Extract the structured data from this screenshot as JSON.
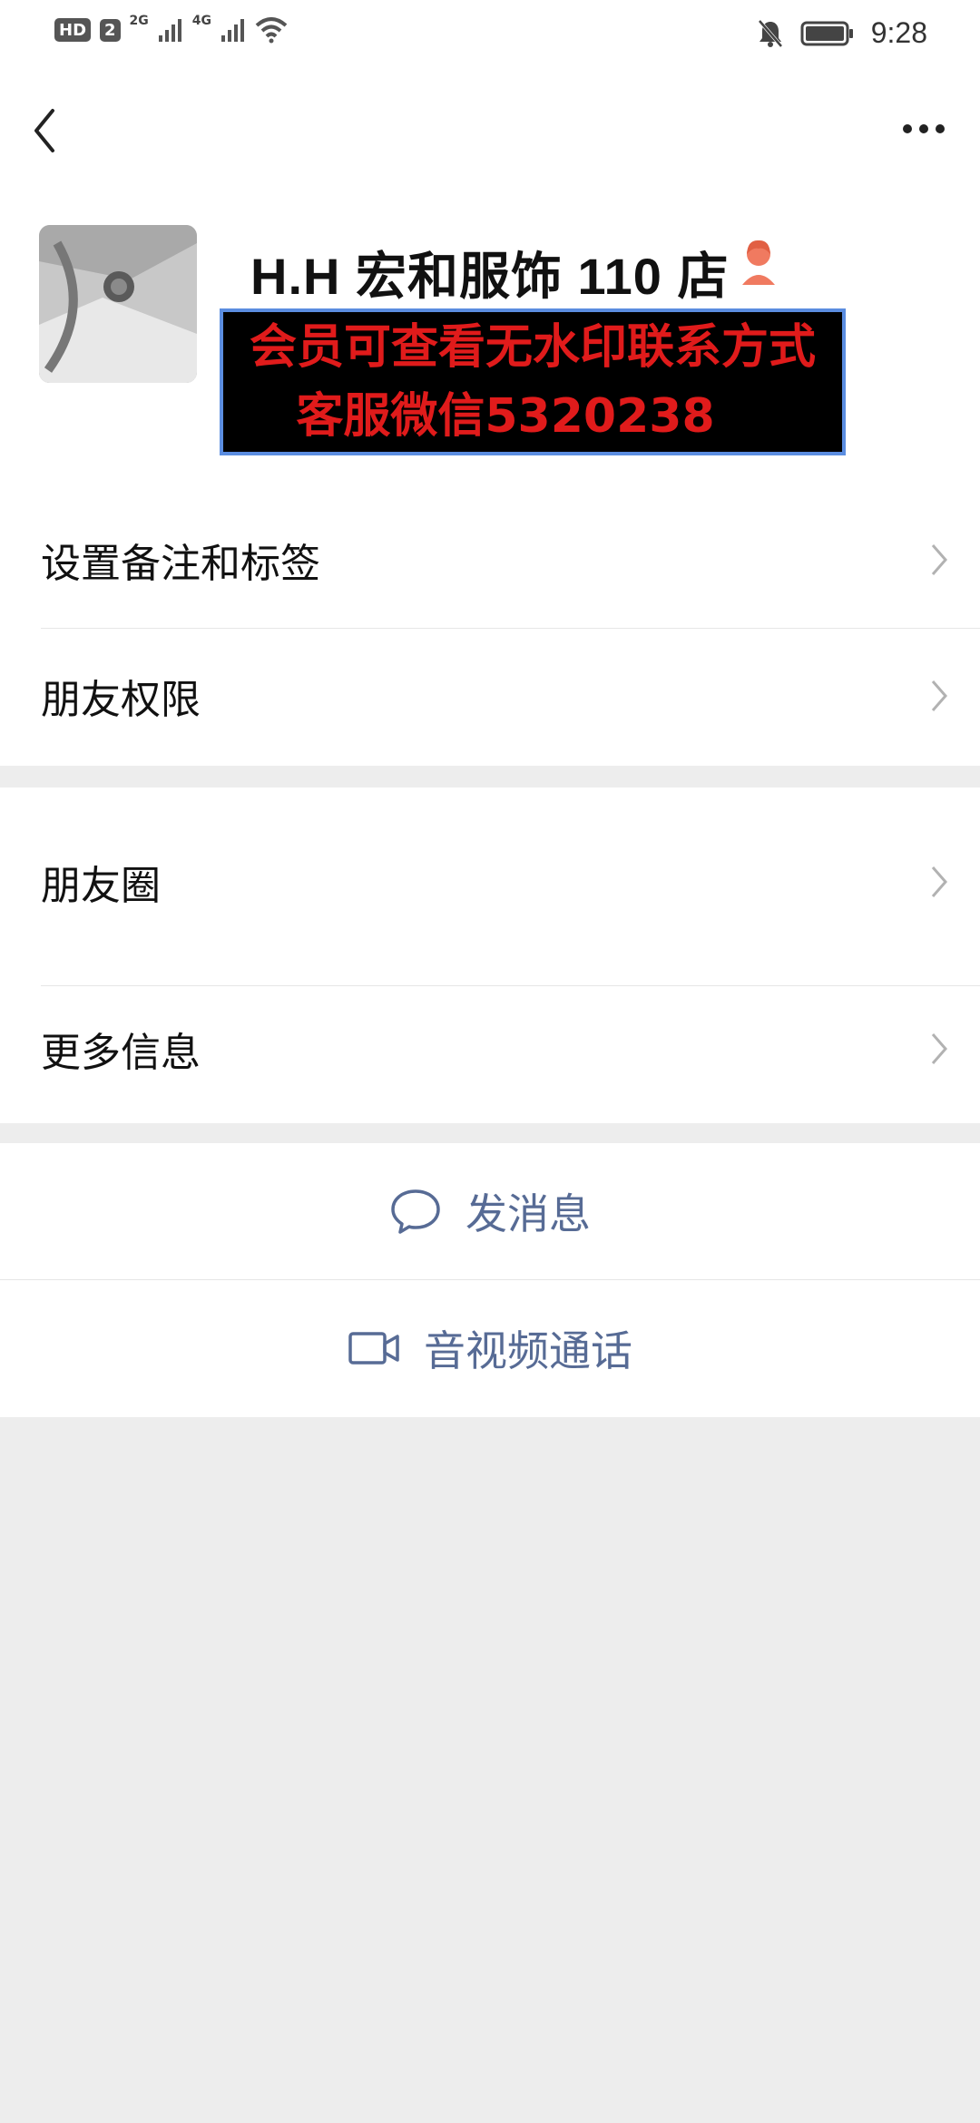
{
  "status_bar": {
    "hd_label": "HD",
    "sim_label": "2",
    "net1": "2G",
    "net2": "4G",
    "time": "9:28",
    "icons": [
      "signal-icon",
      "wifi-icon",
      "mute-icon",
      "battery-icon"
    ]
  },
  "header": {
    "back_icon": "chevron-left-icon",
    "more_icon": "more-dots-icon"
  },
  "profile": {
    "name": "H.H 宏和服饰 110 店",
    "gender_icon": "female-icon",
    "overlay_line1": "会员可查看无水印联系方式",
    "overlay_line2": "客服微信5320238"
  },
  "settings": {
    "group1": [
      {
        "label": "设置备注和标签"
      },
      {
        "label": "朋友权限"
      }
    ],
    "group2": [
      {
        "label": "朋友圈"
      },
      {
        "label": "更多信息"
      }
    ]
  },
  "actions": [
    {
      "label": "发消息",
      "icon": "chat-bubble-icon"
    },
    {
      "label": "音视频通话",
      "icon": "video-call-icon"
    }
  ],
  "colors": {
    "link": "#576b95",
    "background": "#ededed",
    "overlay_text": "#e01b1b",
    "overlay_border": "#5b8de0"
  }
}
